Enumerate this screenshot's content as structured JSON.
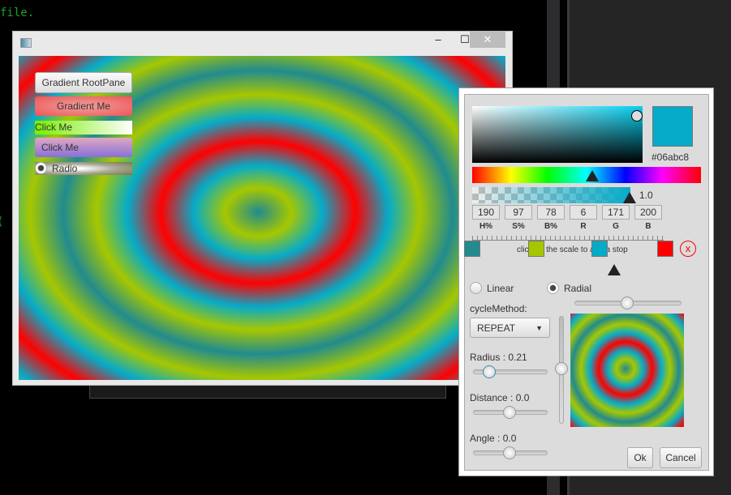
{
  "background": {
    "code_text": "file.",
    "code_fragment": "("
  },
  "window": {
    "minimize": "‒",
    "maximize": "☐",
    "close": "✕",
    "buttons": {
      "gradient_rootpane": "Gradient RootPane",
      "gradient_me": "Gradient Me",
      "click_me_1": "Click Me",
      "click_me_2": "Click Me",
      "radio": "Radio"
    }
  },
  "picker": {
    "hex": "#06abc8",
    "color": "#06abc8",
    "alpha": "1.0",
    "fields": [
      {
        "label": "H%",
        "value": "190"
      },
      {
        "label": "S%",
        "value": "97"
      },
      {
        "label": "B%",
        "value": "78"
      },
      {
        "label": "R",
        "value": "6"
      },
      {
        "label": "G",
        "value": "171"
      },
      {
        "label": "B",
        "value": "200"
      }
    ],
    "scale_hint": "click on the scale to add a stop",
    "stops": [
      {
        "color": "#218b8f",
        "offset": 0
      },
      {
        "color": "#a6c700",
        "offset": 0.33
      },
      {
        "color": "#06abc8",
        "offset": 0.66
      },
      {
        "color": "#ff0000",
        "offset": 1
      }
    ],
    "type_linear": "Linear",
    "type_radial": "Radial",
    "selected_type": "Radial",
    "cycle_label": "cycleMethod:",
    "cycle_value": "REPEAT",
    "radius_label": "Radius : 0.21",
    "radius": 0.21,
    "distance_label": "Distance : 0.0",
    "distance": 0.0,
    "angle_label": "Angle : 0.0",
    "angle": 0.0,
    "ok": "Ok",
    "cancel": "Cancel"
  }
}
